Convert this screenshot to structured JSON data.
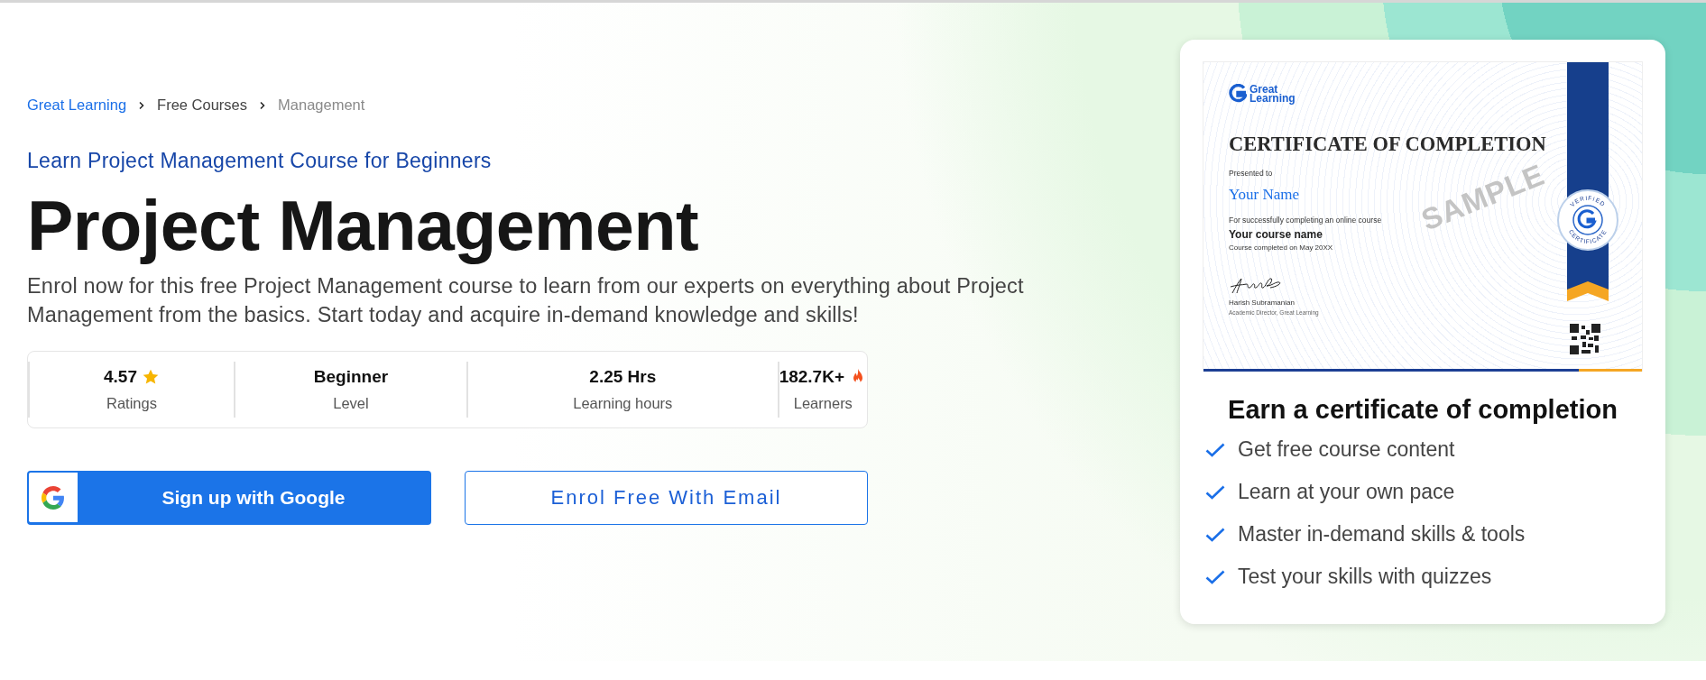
{
  "breadcrumb": [
    {
      "label": "Great Learning",
      "kind": "link"
    },
    {
      "label": "Free Courses",
      "kind": "link"
    },
    {
      "label": "Management",
      "kind": "current"
    }
  ],
  "subtitle": "Learn Project Management Course for Beginners",
  "title": "Project Management",
  "description": "Enrol now for this free Project Management course to learn from our experts on everything about Project Management from the basics. Start today and acquire in-demand knowledge and skills!",
  "stats": [
    {
      "value": "4.57",
      "label": "Ratings",
      "kind": "rating"
    },
    {
      "value": "Beginner",
      "label": "Level",
      "kind": "plain"
    },
    {
      "value": "2.25 Hrs",
      "label": "Learning hours",
      "kind": "plain"
    },
    {
      "value": "182.7K+",
      "label": "Learners",
      "kind": "popular"
    }
  ],
  "buttons": [
    {
      "label": "Sign up with Google",
      "kind": "google"
    },
    {
      "label": "Enrol Free With Email",
      "kind": "outline"
    }
  ],
  "certificate": {
    "logo": "Great Learning",
    "heading": "CERTIFICATE OF COMPLETION",
    "presented": "Presented to",
    "name": "Your Name",
    "reason": "For successfully completing an online course",
    "course": "Your course name",
    "completed": "Course completed on May 20XX",
    "signer": "Harish Subramanian",
    "signer_role": "Academic Director, Great Learning",
    "stamp": "SAMPLE",
    "badge_top": "VERIFIED",
    "badge_bottom": "CERTIFICATE"
  },
  "card": {
    "heading": "Earn a certificate of completion",
    "features": [
      "Get free course content",
      "Learn at your own pace",
      "Master in-demand skills & tools",
      "Test your skills with quizzes"
    ]
  }
}
